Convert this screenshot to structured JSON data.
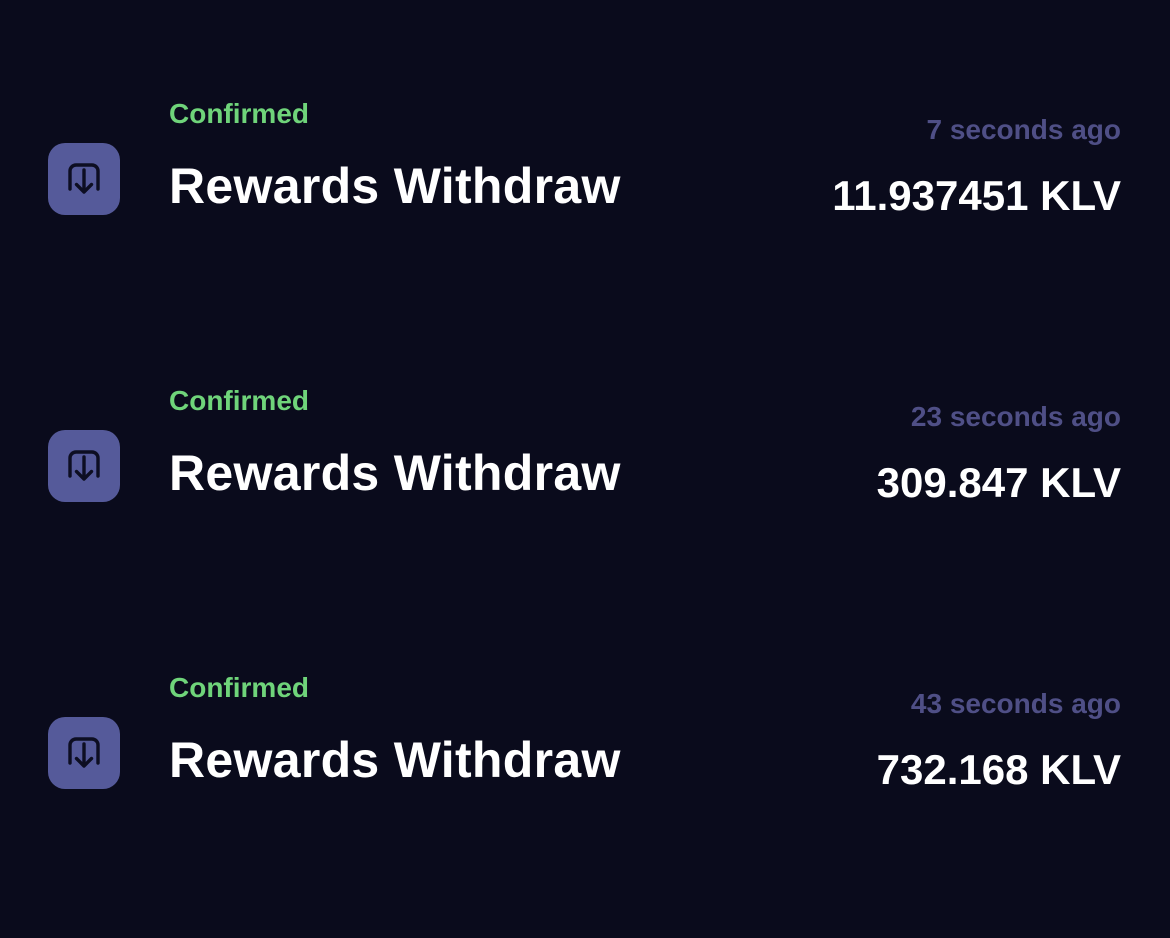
{
  "colors": {
    "background": "#0a0b1c",
    "confirmed": "#6fd47a",
    "timestamp": "#4f4f86",
    "icon_bg": "#555a9a",
    "icon_glyph": "#0d0e22"
  },
  "transactions": [
    {
      "status": "Confirmed",
      "title": "Rewards Withdraw",
      "time": "7 seconds ago",
      "amount": "11.937451 KLV",
      "icon": "withdraw-icon"
    },
    {
      "status": "Confirmed",
      "title": "Rewards Withdraw",
      "time": "23 seconds ago",
      "amount": "309.847 KLV",
      "icon": "withdraw-icon"
    },
    {
      "status": "Confirmed",
      "title": "Rewards Withdraw",
      "time": "43 seconds ago",
      "amount": "732.168 KLV",
      "icon": "withdraw-icon"
    }
  ]
}
